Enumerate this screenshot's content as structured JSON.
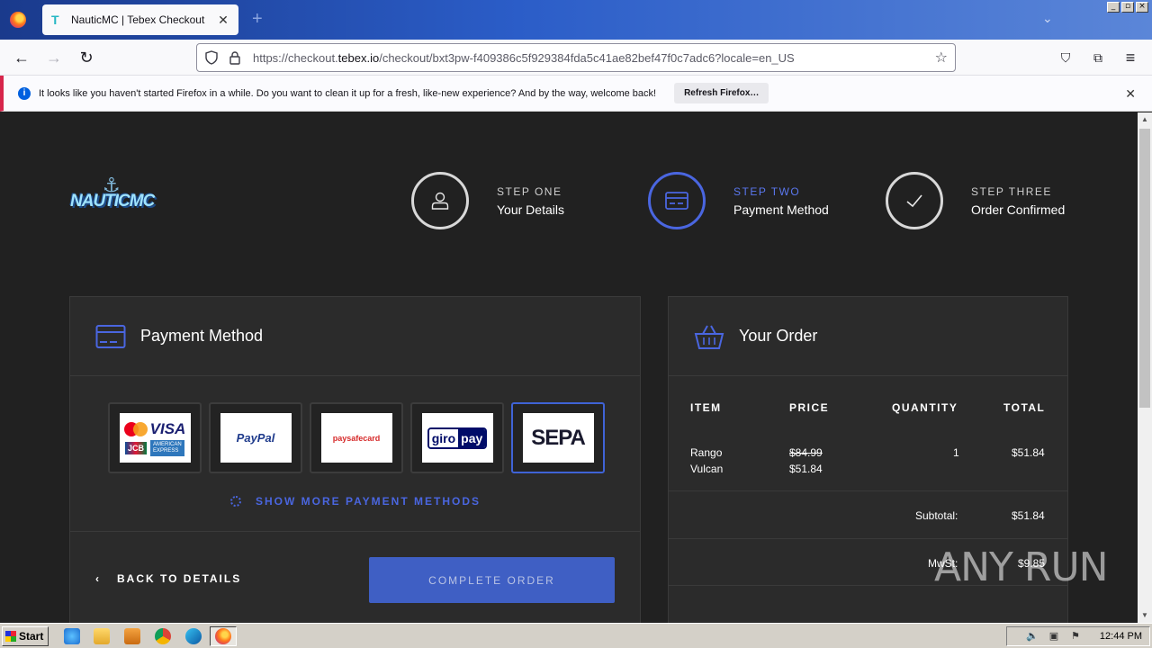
{
  "browser": {
    "tab_title": "NauticMC | Tebex Checkout",
    "tab_favicon": "T",
    "url_prefix": "https://checkout.",
    "url_domain": "tebex.io",
    "url_rest": "/checkout/bxt3pw-f409386c5f929384fda5c41ae82bef47f0c7adc6?locale=en_US"
  },
  "notification": {
    "text": "It looks like you haven't started Firefox in a while. Do you want to clean it up for a fresh, like-new experience? And by the way, welcome back!",
    "button_label": "Refresh Firefox…"
  },
  "logo": {
    "text": "NAUTICMC"
  },
  "steps": [
    {
      "label": "STEP ONE",
      "name": "Your Details",
      "icon": "user-icon"
    },
    {
      "label": "STEP TWO",
      "name": "Payment Method",
      "icon": "credit-card-icon"
    },
    {
      "label": "STEP THREE",
      "name": "Order Confirmed",
      "icon": "checkmark-icon"
    }
  ],
  "payment": {
    "title": "Payment Method",
    "methods": [
      "VISA",
      "PayPal",
      "paysafecard",
      "giropay",
      "SEPA"
    ],
    "methods_sub": {
      "card_jcb": "JCB",
      "card_amex": "AMERICAN EXPRESS",
      "giro_a": "giro",
      "giro_b": "pay"
    },
    "show_more": "SHOW MORE PAYMENT METHODS",
    "back_label": "BACK TO DETAILS",
    "complete_label": "COMPLETE ORDER"
  },
  "order": {
    "title": "Your Order",
    "headers": {
      "item": "ITEM",
      "price": "PRICE",
      "quantity": "QUANTITY",
      "total": "TOTAL"
    },
    "rows": [
      {
        "item_line1": "Rango",
        "item_line2": "Vulcan",
        "price_old": "$84.99",
        "price_new": "$51.84",
        "quantity": "1",
        "total": "$51.84"
      }
    ],
    "subtotal_label": "Subtotal:",
    "subtotal_value": "$51.84",
    "tax_label": "MwSt:",
    "tax_value": "$9.85"
  },
  "watermark": "ANY RUN",
  "taskbar": {
    "start": "Start",
    "clock": "12:44 PM"
  },
  "colors": {
    "accent": "#4a66e0",
    "button": "#3f5fc4",
    "page_bg": "#212121",
    "card_bg": "#2b2b2b"
  }
}
